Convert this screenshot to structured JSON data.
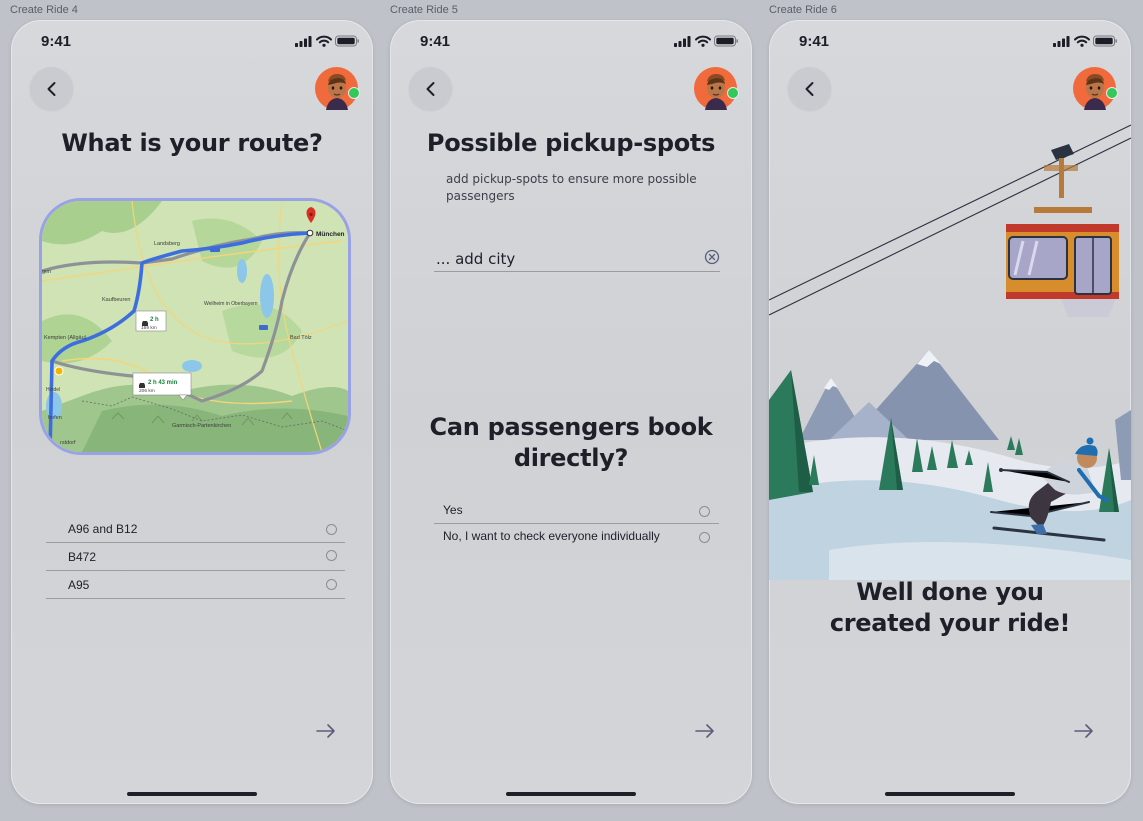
{
  "frames": [
    {
      "label": "Create Ride 4",
      "time": "9:41",
      "title": "What is your route?",
      "map": {
        "city": "München",
        "towns": [
          "Landsberg",
          "Kaufbeuren",
          "Weilheim in Oberbayern",
          "Bad Tölz",
          "Kempten (Allgäu)",
          "Garmisch-Partenkirchen",
          "gen",
          "rstdorf",
          "hofen",
          "Hindel"
        ],
        "route_a": {
          "time": "2 h",
          "distance": "169 km"
        },
        "route_b": {
          "time": "2 h 43 min",
          "distance": "206 km"
        }
      },
      "options": [
        "A96 and B12",
        "B472",
        "A95"
      ]
    },
    {
      "label": "Create Ride 5",
      "time": "9:41",
      "title": "Possible pickup-spots",
      "subtitle": "add pickup-spots to ensure more possible passengers",
      "city_input": {
        "value": "... add city"
      },
      "question": "Can passengers book directly?",
      "options": [
        "Yes",
        "No, I want to check everyone individually"
      ]
    },
    {
      "label": "Create Ride 6",
      "time": "9:41",
      "message": "Well done you created your ride!"
    }
  ],
  "icons": {
    "back": "chevron-left-icon",
    "next": "arrow-right-icon",
    "avatar": "user-avatar",
    "clear": "clear-circle-icon",
    "signal": "signal-icon",
    "wifi": "wifi-icon",
    "battery": "battery-icon"
  },
  "colors": {
    "accent": "#9aa2e6",
    "online": "#34c759",
    "avatar_bg": "#f06a3b"
  }
}
